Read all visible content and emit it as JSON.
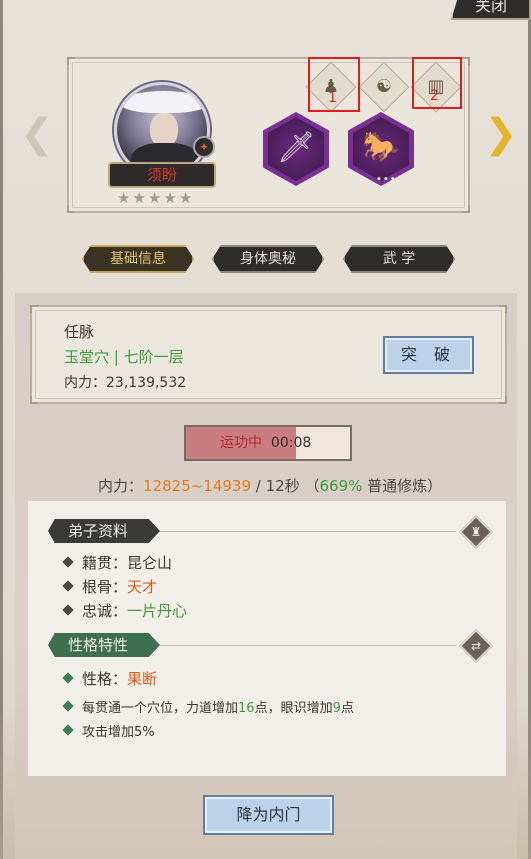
{
  "header": {
    "close_label": "关闭"
  },
  "character": {
    "name": "须盼",
    "stars": [
      "★",
      "★",
      "★",
      "★",
      "★"
    ],
    "slot_markers": {
      "first": "1",
      "second": "2"
    }
  },
  "tabs": [
    {
      "label": "基础信息",
      "active": true
    },
    {
      "label": "身体奥秘",
      "active": false
    },
    {
      "label": "武 学",
      "active": false
    }
  ],
  "meridian": {
    "title": "任脉",
    "status": "玉堂穴 | 七阶一层",
    "power_label": "内力：",
    "power_value": "23,139,532",
    "breakthrough_label": "突 破"
  },
  "training": {
    "timer_label": "运功中",
    "timer_value": "00:08",
    "progress": 0.67,
    "rate_prefix": "内力：",
    "rate_range": "12825~14939",
    "rate_mid": " / 12秒 （",
    "rate_percent": "669%",
    "rate_suffix": " 普通修炼）"
  },
  "profile": {
    "section_title": "弟子资料",
    "rows": [
      {
        "label": "籍贯：",
        "value": "昆仑山"
      },
      {
        "label": "根骨：",
        "value": "天才"
      },
      {
        "label": "忠诚：",
        "value": "一片丹心"
      }
    ]
  },
  "traits": {
    "section_title": "性格特性",
    "personality_label": "性格：",
    "personality_value": "果断",
    "effect1_pre": "每贯通一个穴位，力道增加",
    "effect1_n1": "16",
    "effect1_mid": "点，眼识增加",
    "effect1_n2": "9",
    "effect1_post": "点",
    "effect2": "攻击增加5%"
  },
  "footer": {
    "demote_label": "降为内门"
  },
  "colors": {
    "accent_red": "#d23a30",
    "highlight_red": "#e21b1b",
    "green": "#3d9a38",
    "orange": "#e07d1a",
    "button_blue": "#bcd2ea"
  }
}
